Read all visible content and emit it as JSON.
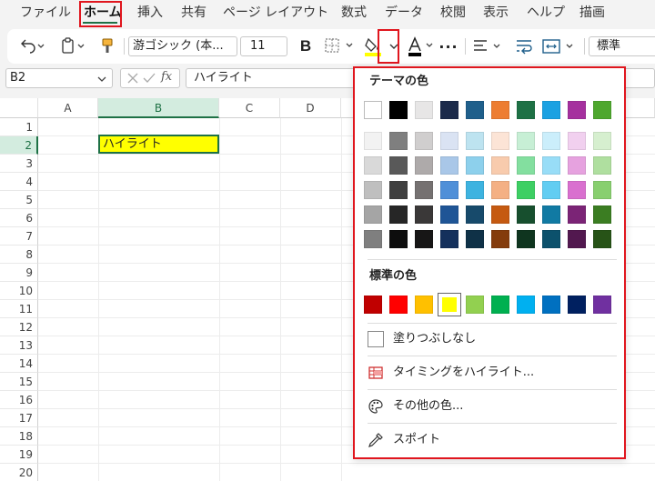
{
  "menu": {
    "items": [
      "ファイル",
      "ホーム",
      "挿入",
      "共有",
      "ページ レイアウト",
      "数式",
      "データ",
      "校閲",
      "表示",
      "ヘルプ",
      "描画"
    ],
    "active": "ホーム"
  },
  "toolbar": {
    "font_name": "游ゴシック (本...",
    "font_size": "11",
    "bold": "B",
    "more": "···",
    "number_format": "標準"
  },
  "formula_bar": {
    "name_box": "B2",
    "fx": "fx",
    "formula": "ハイライト"
  },
  "sheet": {
    "columns": [
      "A",
      "B",
      "C",
      "D"
    ],
    "selected_column": "B",
    "rows": [
      "1",
      "2",
      "3",
      "4",
      "5",
      "6",
      "7",
      "8",
      "9",
      "10",
      "11",
      "12",
      "13",
      "14",
      "15",
      "16",
      "17",
      "18",
      "19",
      "20"
    ],
    "selected_row": "2",
    "cell_b2": "ハイライト"
  },
  "fill_color_menu": {
    "theme_title": "テーマの色",
    "standard_title": "標準の色",
    "theme_colors": [
      [
        "#ffffff",
        "#000000",
        "#e7e6e6",
        "#1b2a4a",
        "#1f5f8b",
        "#ed7d31",
        "#1e7145",
        "#1ba1e2",
        "#a5309e",
        "#4ea72e"
      ],
      [
        "#f2f2f2",
        "#7f7f7f",
        "#d0cece",
        "#dae3f3",
        "#bde3f0",
        "#fce4d6",
        "#c7efd5",
        "#cbeefb",
        "#f1d0ef",
        "#d6efcf"
      ],
      [
        "#d9d9d9",
        "#595959",
        "#aeaaaa",
        "#a9c7e8",
        "#8dd0ec",
        "#f8cbad",
        "#83df9f",
        "#98ddf7",
        "#e6a2df",
        "#afdf9f"
      ],
      [
        "#bfbfbf",
        "#3f3f3f",
        "#757171",
        "#4f8fd8",
        "#3db3e0",
        "#f4b084",
        "#3dcf63",
        "#62cdf2",
        "#d970cf",
        "#88cf6f"
      ],
      [
        "#a5a5a5",
        "#262626",
        "#3a3838",
        "#1f5596",
        "#174a6b",
        "#c55a11",
        "#174f2e",
        "#117aa3",
        "#7b2476",
        "#3b7d22"
      ],
      [
        "#7f7f7f",
        "#0d0d0d",
        "#171616",
        "#14305c",
        "#0f3147",
        "#843c0c",
        "#0f351f",
        "#0c516c",
        "#52184f",
        "#275317"
      ]
    ],
    "standard_colors": [
      "#c00000",
      "#ff0000",
      "#ffc000",
      "#ffff00",
      "#92d050",
      "#00b050",
      "#00b0f0",
      "#0070c0",
      "#002060",
      "#7030a0"
    ],
    "selected_standard": "#ffff00",
    "options": {
      "no_fill": "塗りつぶしなし",
      "highlight_timing": "タイミングをハイライト...",
      "more_colors": "その他の色...",
      "eyedropper": "スポイト"
    }
  }
}
